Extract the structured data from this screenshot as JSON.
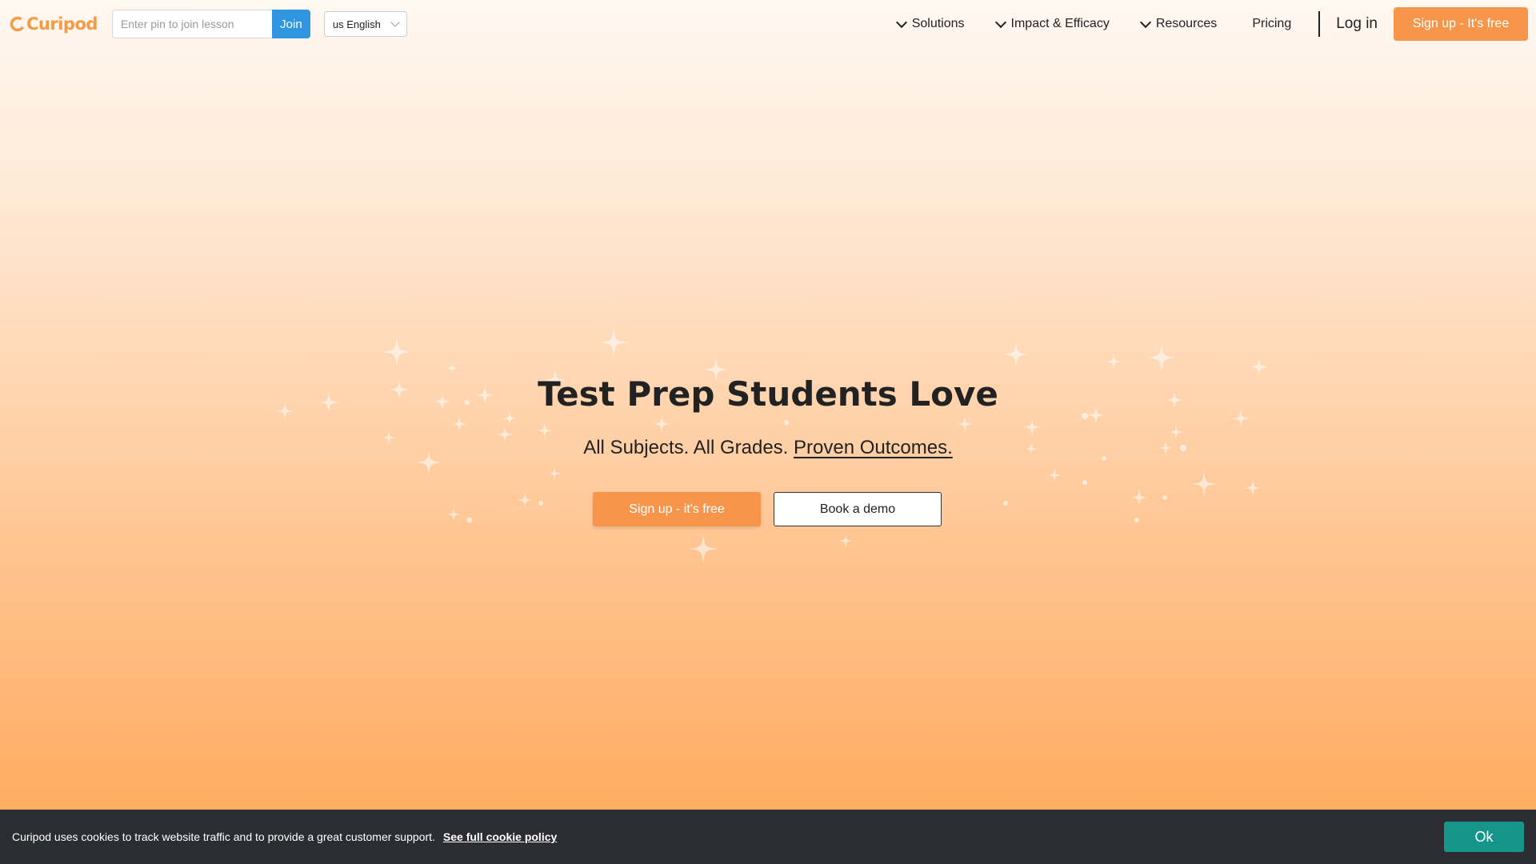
{
  "brand": {
    "name": "Curipod",
    "color": "#f59a45"
  },
  "header": {
    "pin_placeholder": "Enter pin to join lesson",
    "join_label": "Join",
    "language": "us English",
    "nav": [
      {
        "label": "Solutions",
        "has_dropdown": true
      },
      {
        "label": "Impact & Efficacy",
        "has_dropdown": true
      },
      {
        "label": "Resources",
        "has_dropdown": true
      },
      {
        "label": "Pricing",
        "has_dropdown": false
      }
    ],
    "login_label": "Log in",
    "signup_label": "Sign up - It's free"
  },
  "hero": {
    "title": "Test Prep Students Love",
    "subtitle_prefix": "All Subjects. All Grades.",
    "subtitle_link": "Proven Outcomes.",
    "primary_cta": "Sign up - it's free",
    "secondary_cta": "Book a demo"
  },
  "cookie": {
    "text": "Curipod uses cookies to track website traffic and to provide a great customer support.",
    "link": "See full cookie policy",
    "ok_label": "Ok"
  },
  "colors": {
    "accent_orange": "#f7964a",
    "join_blue": "#3196e0",
    "cookie_bg": "#2b2d32",
    "ok_teal": "#16958a"
  }
}
